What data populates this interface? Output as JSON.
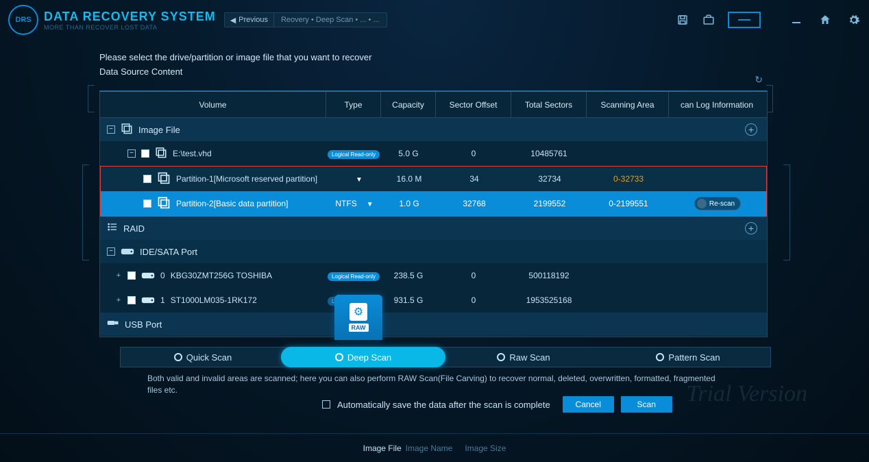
{
  "app": {
    "title": "DATA RECOVERY SYSTEM",
    "subtitle": "MORE THAN RECOVER LOST DATA",
    "logo_abbrev": "DRS"
  },
  "breadcrumb": {
    "prev_label": "Previous",
    "path": "Reovery  •  Deep Scan  •  ...  •  ..."
  },
  "instruction": "Please select the drive/partition or image file that you want to recover",
  "data_source_label": "Data Source Content",
  "table": {
    "headers": {
      "volume": "Volume",
      "type": "Type",
      "capacity": "Capacity",
      "sector_offset": "Sector Offset",
      "total_sectors": "Total Sectors",
      "scanning_area": "Scanning Area",
      "log_info": "can Log Information"
    },
    "groups": {
      "image_file": {
        "label": "Image File",
        "file": {
          "name": "E:\\test.vhd",
          "badge": "Logical Read-only",
          "capacity": "5.0 G",
          "sector_offset": "0",
          "total_sectors": "10485761"
        },
        "partitions": [
          {
            "name": "Partition-1[Microsoft reserved partition]",
            "type": "",
            "capacity": "16.0 M",
            "sector_offset": "34",
            "total_sectors": "32734",
            "scanning_area": "0-32733"
          },
          {
            "name": "Partition-2[Basic data partition]",
            "type": "NTFS",
            "capacity": "1.0 G",
            "sector_offset": "32768",
            "total_sectors": "2199552",
            "scanning_area": "0-2199551",
            "rescan_label": "Re-scan"
          }
        ]
      },
      "raid": {
        "label": "RAID"
      },
      "ide_sata": {
        "label": "IDE/SATA Port",
        "drives": [
          {
            "index": "0",
            "name": "KBG30ZMT256G TOSHIBA",
            "badge": "Logical Read-only",
            "capacity": "238.5 G",
            "sector_offset": "0",
            "total_sectors": "500118192"
          },
          {
            "index": "1",
            "name": "ST1000LM035-1RK172",
            "badge": "Logical Read-only",
            "capacity": "931.5 G",
            "sector_offset": "0",
            "total_sectors": "1953525168"
          }
        ]
      },
      "usb": {
        "label": "USB Port"
      }
    }
  },
  "scan_modes": {
    "quick": "Quick Scan",
    "deep": "Deep Scan",
    "raw": "Raw Scan",
    "pattern": "Pattern Scan"
  },
  "raw_overlay_label": "RAW",
  "scan_description": "Both valid and invalid areas are scanned; here you can also perform RAW Scan(File Carving) to recover normal, deleted, overwritten, formatted, fragmented files etc.",
  "auto_save_label": "Automatically save the data after the scan is complete",
  "buttons": {
    "cancel": "Cancel",
    "scan": "Scan"
  },
  "watermark": "Trial Version",
  "status": {
    "label": "Image File",
    "name_placeholder": "Image Name",
    "size_placeholder": "Image Size"
  }
}
